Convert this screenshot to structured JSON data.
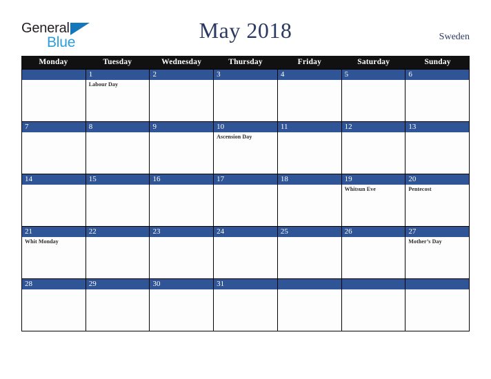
{
  "brand": {
    "name_part1": "General",
    "name_part2": "Blue",
    "triangle_color": "#1477ba",
    "blue_color": "#2a9ddc",
    "dark_color": "#231f20"
  },
  "header": {
    "title": "May 2018",
    "country": "Sweden",
    "title_color": "#2b3a62"
  },
  "calendar": {
    "weekday_headers": [
      "Monday",
      "Tuesday",
      "Wednesday",
      "Thursday",
      "Friday",
      "Saturday",
      "Sunday"
    ],
    "header_bg": "#111111",
    "band_color": "#2f5596",
    "weeks": [
      [
        {
          "num": "",
          "events": []
        },
        {
          "num": "1",
          "events": [
            "Labour Day"
          ]
        },
        {
          "num": "2",
          "events": []
        },
        {
          "num": "3",
          "events": []
        },
        {
          "num": "4",
          "events": []
        },
        {
          "num": "5",
          "events": []
        },
        {
          "num": "6",
          "events": []
        }
      ],
      [
        {
          "num": "7",
          "events": []
        },
        {
          "num": "8",
          "events": []
        },
        {
          "num": "9",
          "events": []
        },
        {
          "num": "10",
          "events": [
            "Ascension Day"
          ]
        },
        {
          "num": "11",
          "events": []
        },
        {
          "num": "12",
          "events": []
        },
        {
          "num": "13",
          "events": []
        }
      ],
      [
        {
          "num": "14",
          "events": []
        },
        {
          "num": "15",
          "events": []
        },
        {
          "num": "16",
          "events": []
        },
        {
          "num": "17",
          "events": []
        },
        {
          "num": "18",
          "events": []
        },
        {
          "num": "19",
          "events": [
            "Whitsun Eve"
          ]
        },
        {
          "num": "20",
          "events": [
            "Pentecost"
          ]
        }
      ],
      [
        {
          "num": "21",
          "events": [
            "Whit Monday"
          ]
        },
        {
          "num": "22",
          "events": []
        },
        {
          "num": "23",
          "events": []
        },
        {
          "num": "24",
          "events": []
        },
        {
          "num": "25",
          "events": []
        },
        {
          "num": "26",
          "events": []
        },
        {
          "num": "27",
          "events": [
            "Mother’s Day"
          ]
        }
      ],
      [
        {
          "num": "28",
          "events": []
        },
        {
          "num": "29",
          "events": []
        },
        {
          "num": "30",
          "events": []
        },
        {
          "num": "31",
          "events": []
        },
        {
          "num": "",
          "events": []
        },
        {
          "num": "",
          "events": []
        },
        {
          "num": "",
          "events": []
        }
      ]
    ]
  }
}
